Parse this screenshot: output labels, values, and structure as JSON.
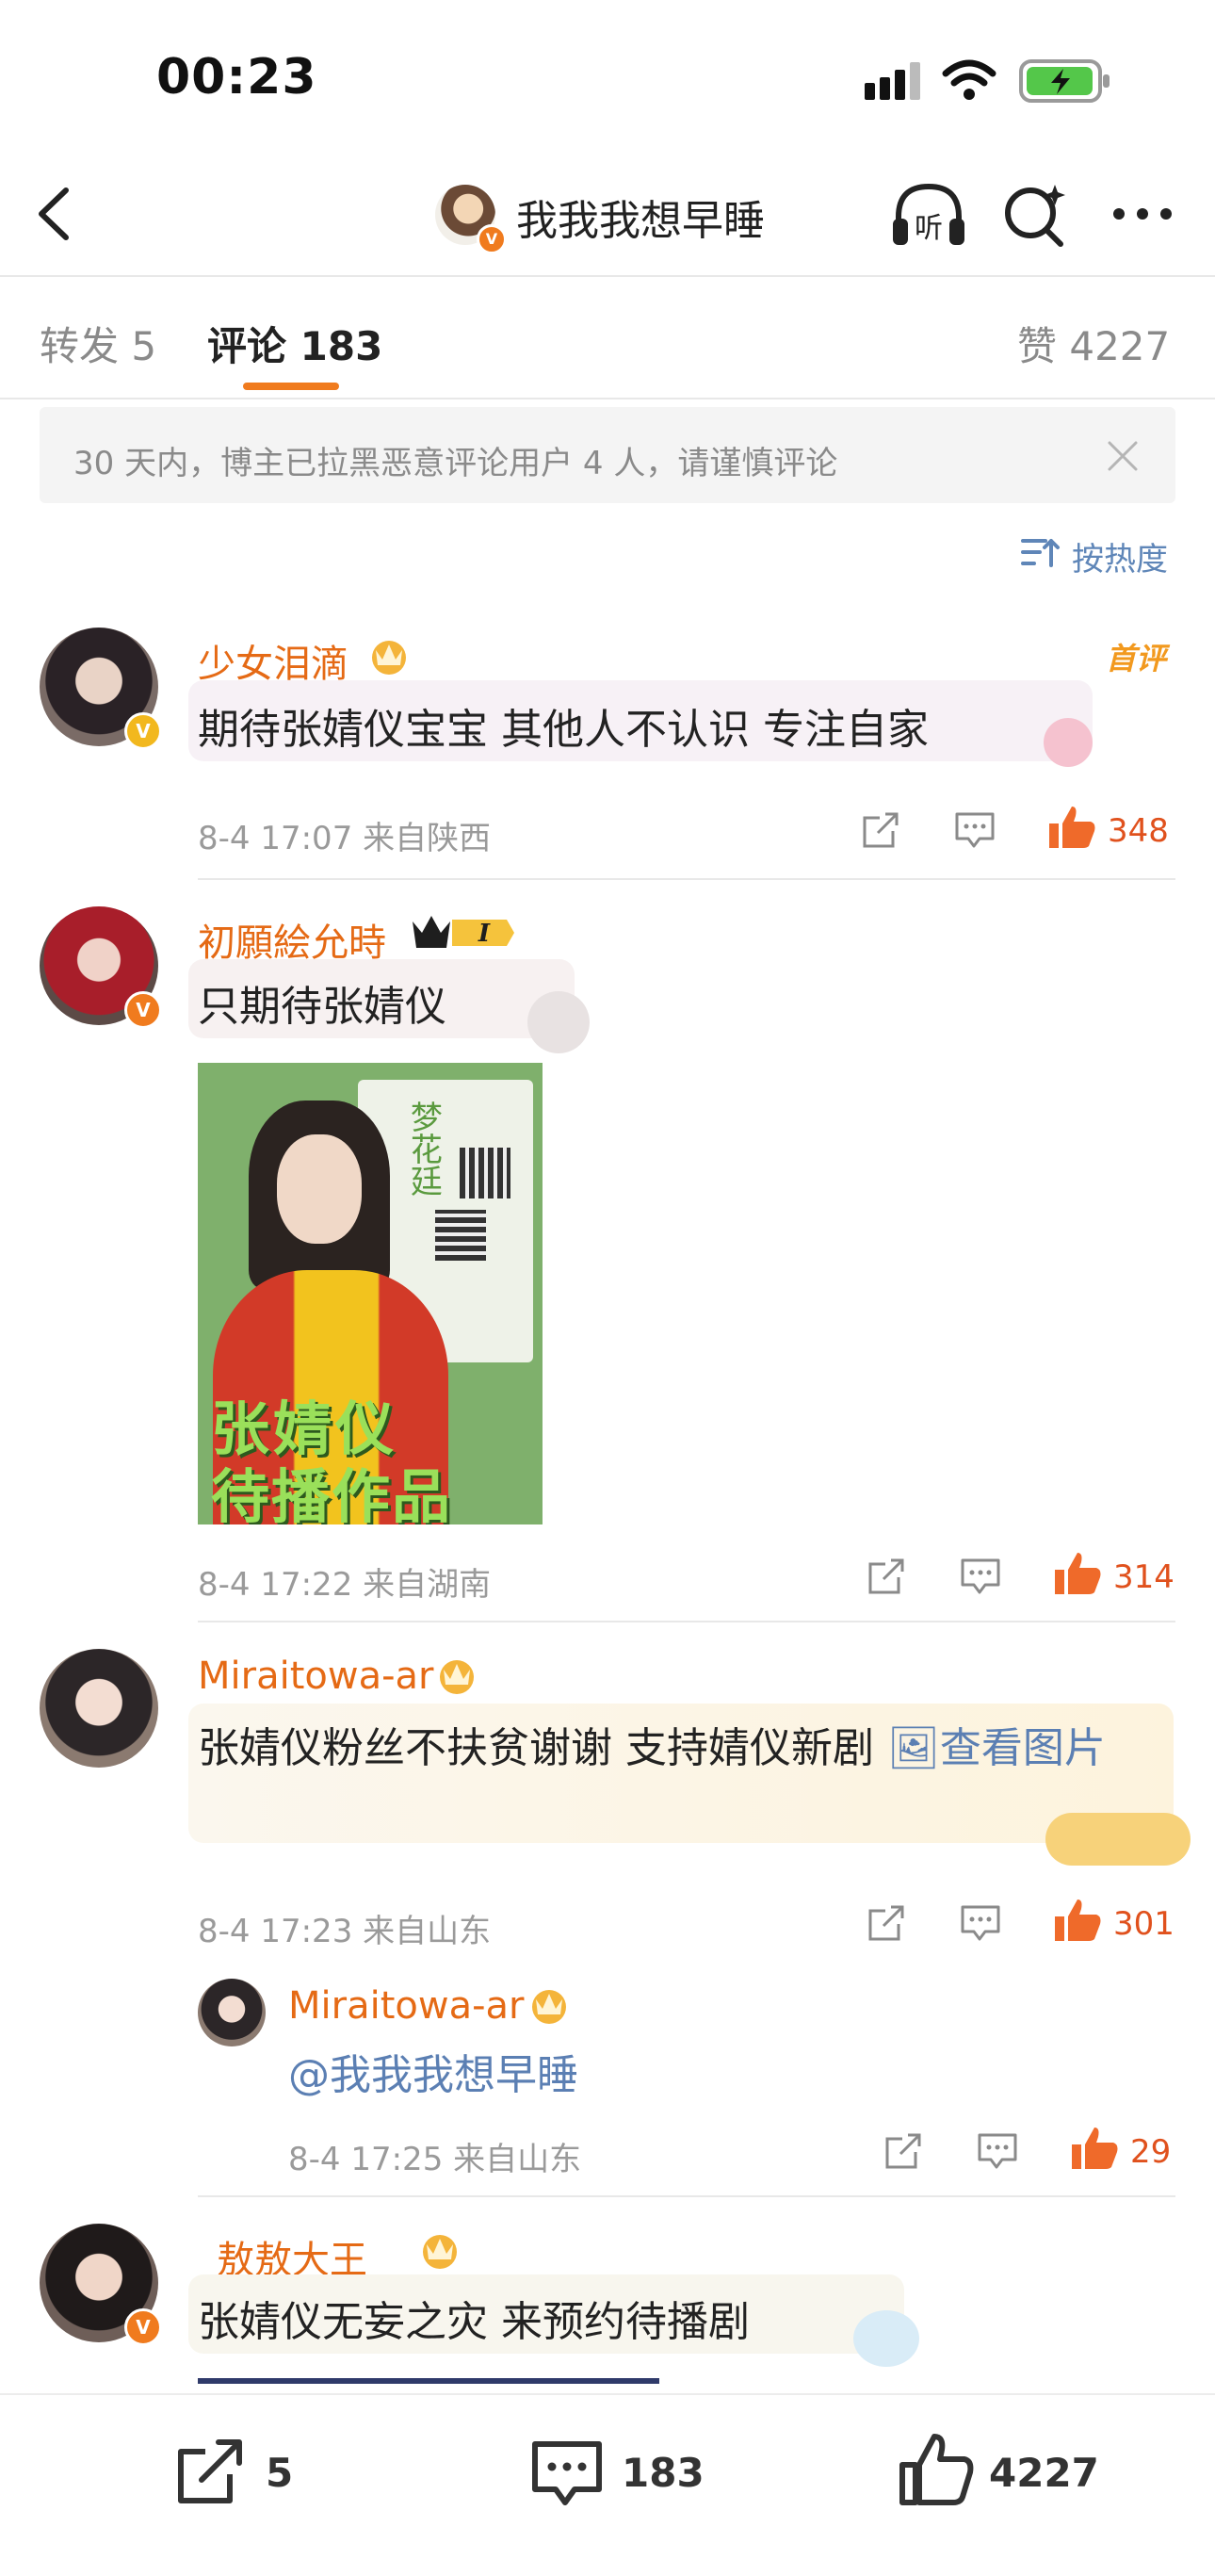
{
  "status_bar": {
    "time": "00:23"
  },
  "nav": {
    "title": "我我我想早睡"
  },
  "tabs": [
    {
      "label": "转发 5"
    },
    {
      "label": "评论 183"
    },
    {
      "label": "赞 4227"
    }
  ],
  "notice": {
    "text": "30 天内，博主已拉黑恶意评论用户 4 人，请谨慎评论"
  },
  "sort": {
    "label": "按热度"
  },
  "comments": [
    {
      "username": "少女泪滴",
      "badge": "首评",
      "text": "期待张婧仪宝宝 其他人不认识 专注自家",
      "time_location": "8-4 17:07  来自陕西",
      "likes": "348"
    },
    {
      "username": "初願絵允時",
      "level": "I",
      "text": "只期待张婧仪",
      "image": {
        "vertical_title": "梦花廷",
        "headline_1": "张婧仪",
        "headline_2": "待播作品"
      },
      "time_location": "8-4 17:22  来自湖南",
      "likes": "314"
    },
    {
      "username": "Miraitowa-ar",
      "text": "张婧仪粉丝不扶贫谢谢 支持婧仪新剧 ",
      "view_image": "查看图片",
      "time_location": "8-4 17:23  来自山东",
      "likes": "301",
      "reply": {
        "username": "Miraitowa-ar",
        "text": "@我我我想早睡",
        "time_location": "8-4 17:25  来自山东",
        "likes": "29"
      }
    },
    {
      "username": "_敖敖大王_",
      "text": "张婧仪无妄之灾 来预约待播剧"
    }
  ],
  "bottom_bar": {
    "repost": "5",
    "comment": "183",
    "like": "4227"
  },
  "colors": {
    "accent": "#f07b1e",
    "username": "#e56a15",
    "like": "#e0511d",
    "link": "#5b7fb3"
  }
}
